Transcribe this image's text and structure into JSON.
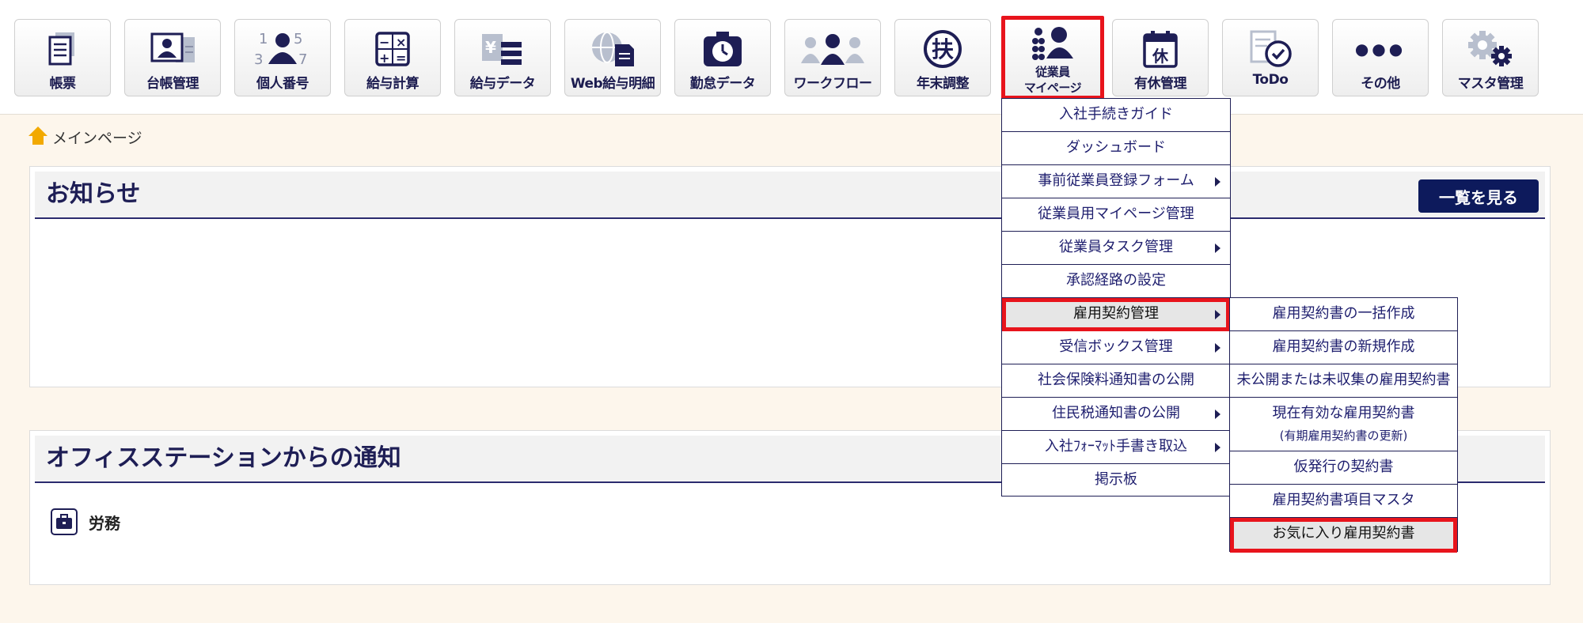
{
  "toolbar": {
    "items": [
      {
        "label": "帳票",
        "icon": "document-icon"
      },
      {
        "label": "台帳管理",
        "icon": "id-card-icon"
      },
      {
        "label": "個人番号",
        "icon": "person-numbers-icon"
      },
      {
        "label": "給与計算",
        "icon": "calculator-icon"
      },
      {
        "label": "給与データ",
        "icon": "salary-data-icon"
      },
      {
        "label": "Web給与明細",
        "icon": "globe-document-icon"
      },
      {
        "label": "勤怠データ",
        "icon": "clock-icon"
      },
      {
        "label": "ワークフロー",
        "icon": "people-workflow-icon"
      },
      {
        "label": "年末調整",
        "icon": "fu-seal-icon"
      },
      {
        "label_line1": "従業員",
        "label_line2": "マイページ",
        "icon": "employee-mypage-icon"
      },
      {
        "label": "有休管理",
        "icon": "calendar-icon",
        "icon_text": "休"
      },
      {
        "label": "ToDo",
        "icon": "todo-check-icon"
      },
      {
        "label": "その他",
        "icon": "more-dots-icon",
        "icon_text": "●●●"
      },
      {
        "label": "マスタ管理",
        "icon": "gears-icon"
      }
    ]
  },
  "breadcrumb": {
    "label": "メインページ",
    "icon": "home-icon"
  },
  "notice": {
    "title": "お知らせ",
    "list_button": "一覧を見る"
  },
  "station": {
    "title": "オフィスステーションからの通知",
    "labor_label": "労務",
    "labor_icon": "briefcase-icon"
  },
  "menu": {
    "items": [
      {
        "label": "入社手続きガイド",
        "has_submenu": false
      },
      {
        "label": "ダッシュボード",
        "has_submenu": false
      },
      {
        "label": "事前従業員登録フォーム",
        "has_submenu": true
      },
      {
        "label": "従業員用マイページ管理",
        "has_submenu": false
      },
      {
        "label": "従業員タスク管理",
        "has_submenu": true
      },
      {
        "label": "承認経路の設定",
        "has_submenu": false
      },
      {
        "label": "雇用契約管理",
        "has_submenu": true
      },
      {
        "label": "受信ボックス管理",
        "has_submenu": true
      },
      {
        "label": "社会保険料通知書の公開",
        "has_submenu": false
      },
      {
        "label": "住民税通知書の公開",
        "has_submenu": true
      },
      {
        "label": "入社ﾌｫｰﾏｯﾄ手書き取込",
        "has_submenu": true
      },
      {
        "label": "掲示板",
        "has_submenu": false
      }
    ]
  },
  "submenu": {
    "items": [
      {
        "label": "雇用契約書の一括作成"
      },
      {
        "label": "雇用契約書の新規作成"
      },
      {
        "label": "未公開または未収集の雇用契約書"
      },
      {
        "label": "現在有効な雇用契約書",
        "sub": "(有期雇用契約書の更新)"
      },
      {
        "label": "仮発行の契約書"
      },
      {
        "label": "雇用契約書項目マスタ"
      },
      {
        "label": "お気に入り雇用契約書"
      }
    ]
  },
  "colors": {
    "accent_navy": "#0d1a5c",
    "highlight_red": "#e8141c",
    "background": "#fdf6ec",
    "home_icon": "#f2a900"
  }
}
